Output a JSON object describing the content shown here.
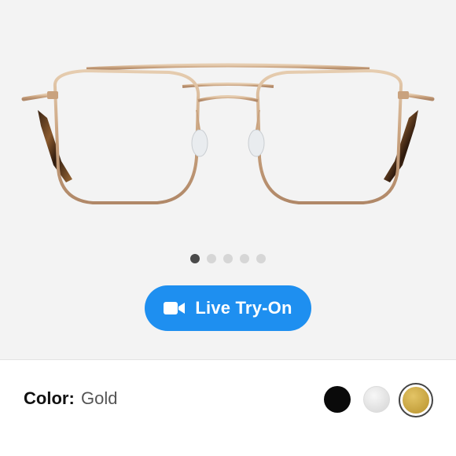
{
  "gallery": {
    "image_subject": "gold-aviator-eyeglasses",
    "dots": [
      {
        "active": true
      },
      {
        "active": false
      },
      {
        "active": false
      },
      {
        "active": false
      },
      {
        "active": false
      }
    ],
    "active_index": 0
  },
  "try_on_button": {
    "label": "Live Try-On",
    "icon": "video-camera-icon",
    "color": "#1e8ff0"
  },
  "color_selector": {
    "label": "Color:",
    "selected_value": "Gold",
    "swatches": [
      {
        "name": "black",
        "color": "#0a0a0a",
        "selected": false
      },
      {
        "name": "silver",
        "color": "#e6e6e6",
        "selected": false
      },
      {
        "name": "gold",
        "color": "#c9a540",
        "selected": true
      }
    ]
  }
}
